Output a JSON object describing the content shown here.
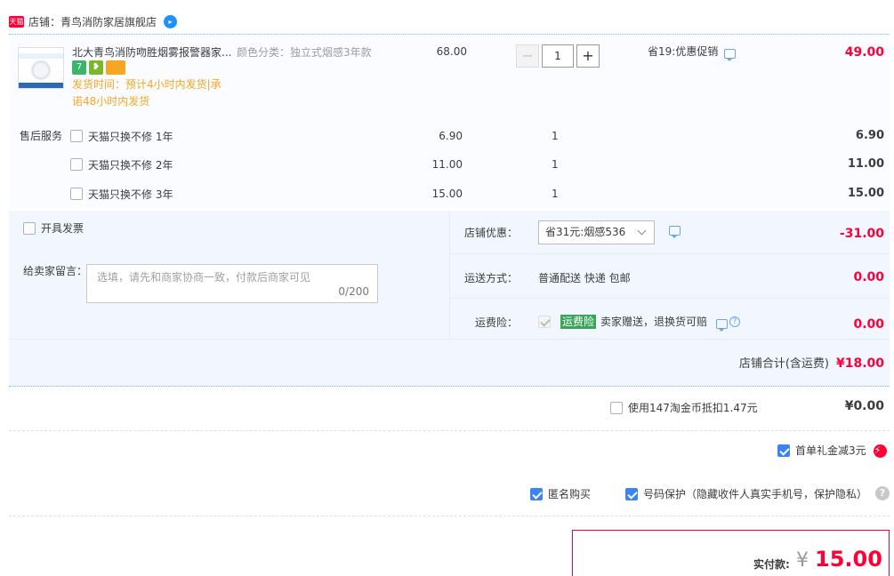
{
  "shop": {
    "tmall_badge": "天猫",
    "label": "店铺：",
    "name": "青鸟消防家居旗舰店",
    "chat_icon": "wangwang-chat-icon"
  },
  "item": {
    "title": "北大青鸟消防吻胜烟雾报警器家...",
    "sku_label": "颜色分类：",
    "sku_value": "独立式烟感3年款",
    "badges": [
      "7",
      "❥",
      ""
    ],
    "ship_time_line1": "发货时间：预计4小时内发货|承",
    "ship_time_line2": "诺48小时内发货",
    "price": "68.00",
    "qty": "1",
    "qty_minus": "−",
    "qty_plus": "+",
    "promo": "省19:优惠促销",
    "subtotal": "49.00"
  },
  "services": {
    "title": "售后服务",
    "rows": [
      {
        "label": "天猫只换不修 1年",
        "price": "6.90",
        "qty": "1",
        "subtotal": "6.90"
      },
      {
        "label": "天猫只换不修 2年",
        "price": "11.00",
        "qty": "1",
        "subtotal": "11.00"
      },
      {
        "label": "天猫只换不修 3年",
        "price": "15.00",
        "qty": "1",
        "subtotal": "15.00"
      }
    ]
  },
  "order": {
    "invoice_label": "开具发票",
    "message_label": "给卖家留言：",
    "message_placeholder": "选填，请先和商家协商一致，付款后商家可见",
    "message_count": "0/200",
    "coupon_label": "店铺优惠：",
    "coupon_value": "省31元:烟感536",
    "coupon_amount": "-31.00",
    "shipping_label": "运送方式：",
    "shipping_value": "普通配送 快递 包邮",
    "shipping_amount": "0.00",
    "insurance_label": "运费险：",
    "insurance_tag": "运费险",
    "insurance_text": "卖家赠送，退换货可赔",
    "insurance_amount": "0.00",
    "shop_total_label": "店铺合计(含运费)",
    "shop_total_value": "¥18.00"
  },
  "coins": {
    "label": "使用147淘金币抵扣1.47元",
    "amount": "¥0.00"
  },
  "gift": {
    "label": "首单礼金减3元"
  },
  "options": {
    "anonymous_label": "匿名购买",
    "phone_protect_label": "号码保护（隐藏收件人真实手机号，保护隐私）"
  },
  "payment": {
    "label": "实付款:",
    "currency": "¥",
    "amount": "15.00"
  },
  "colors": {
    "accent_red": "#ff0036",
    "checkbox_blue": "#3c84f5",
    "insurance_green": "#3aa55a"
  }
}
